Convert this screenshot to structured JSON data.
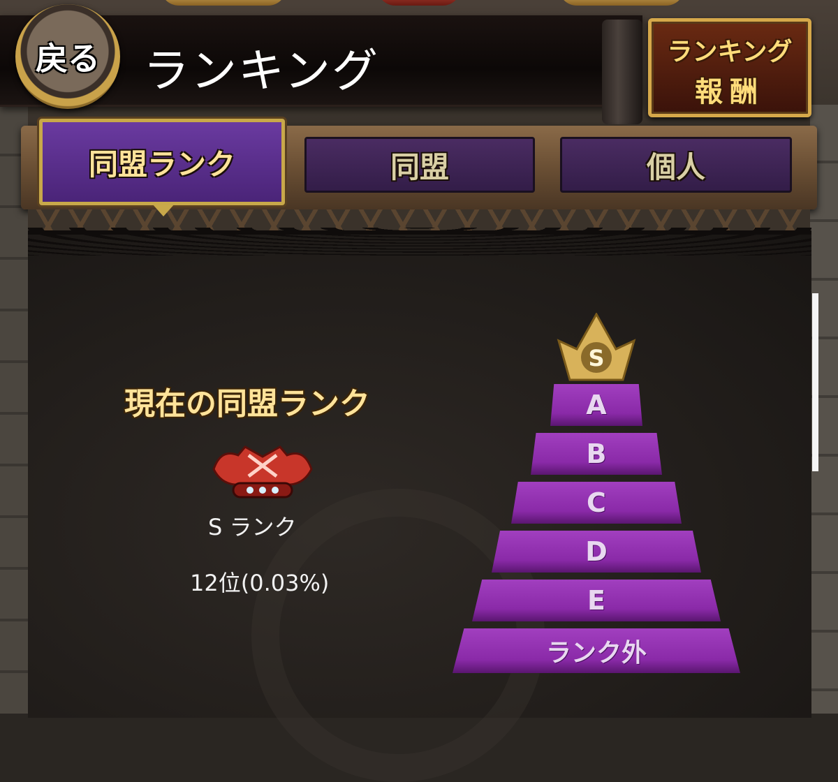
{
  "header": {
    "back_label": "戻る",
    "title": "ランキング",
    "reward_line1": "ランキング",
    "reward_line2": "報酬"
  },
  "tabs": [
    {
      "label": "同盟ランク",
      "active": true
    },
    {
      "label": "同盟",
      "active": false
    },
    {
      "label": "個人",
      "active": false
    }
  ],
  "current": {
    "heading": "現在の同盟ランク",
    "rank_name": "S ランク",
    "position": "12位(0.03%)"
  },
  "pyramid": {
    "top": "S",
    "tiers": [
      "A",
      "B",
      "C",
      "D",
      "E",
      "ランク外"
    ]
  },
  "colors": {
    "tier_purple": "#8a2aa8",
    "gold": "#c8a84a",
    "tab_purple": "#4a2c62"
  }
}
